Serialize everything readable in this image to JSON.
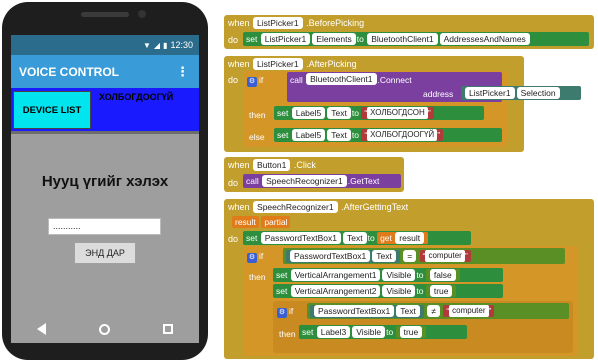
{
  "phone": {
    "status_time": "12:30",
    "app_title": "VOICE CONTROL",
    "menu_icon": "more-vert-icon",
    "device_button": "DEVICE LIST",
    "device_status": "ХОЛБОГДООГҮЙ",
    "prompt": "Нууц үгийг хэлэх",
    "password_value": "...........",
    "submit_button": "ЭНД ДАР"
  },
  "blocks": {
    "b1": {
      "when": "when",
      "component": "ListPicker1",
      "event": ".BeforePicking",
      "do": "do",
      "set": "set",
      "target": "ListPicker1",
      "prop": "Elements",
      "to": "to",
      "source": "BluetoothClient1",
      "source_prop": "AddressesAndNames"
    },
    "b2": {
      "when": "when",
      "component": "ListPicker1",
      "event": ".AfterPicking",
      "do": "do",
      "if": "if",
      "call": "call",
      "call_comp": "BluetoothClient1",
      "method": ".Connect",
      "address": "address",
      "addr_src": "ListPicker1",
      "addr_prop": "Selection",
      "then": "then",
      "set": "set",
      "label": "Label5",
      "text_prop": "Text",
      "to": "to",
      "connected": "ХОЛБОГДСОН",
      "else": "else",
      "not_connected": "ХОЛБОГДООГҮЙ"
    },
    "b3": {
      "when": "when",
      "component": "Button1",
      "event": ".Click",
      "do": "do",
      "call": "call",
      "target": "SpeechRecognizer1",
      "method": ".GetText"
    },
    "b4": {
      "when": "when",
      "component": "SpeechRecognizer1",
      "event": ".AfterGettingText",
      "param1": "result",
      "param2": "partial",
      "do": "do",
      "set": "set",
      "tb": "PasswordTextBox1",
      "text_prop": "Text",
      "to": "to",
      "get": "get",
      "get_var": "result",
      "if": "if",
      "tb2": "PasswordTextBox1",
      "eq": "=",
      "word": "computer",
      "then": "then",
      "va1": "VerticalArrangement1",
      "visible": "Visible",
      "false": "false",
      "va2": "VerticalArrangement2",
      "true": "true",
      "if2": "if",
      "tb3": "PasswordTextBox1",
      "neq": "≠",
      "word2": "computer",
      "then2": "then",
      "label3": "Label3"
    }
  }
}
